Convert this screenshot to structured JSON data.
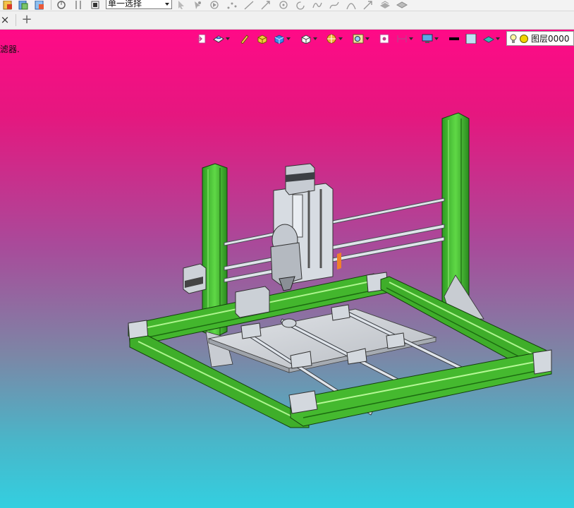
{
  "toolbar": {
    "selection_mode": "单一选择",
    "icons": [
      "document-icon",
      "copy-icon",
      "paste-icon",
      "rotate-icon",
      "reference-icon",
      "stop-icon",
      "pointer-icon",
      "cursor-icon",
      "play-icon",
      "points-icon",
      "line-icon",
      "arrow-line-icon",
      "circle-point-icon",
      "arc-icon",
      "curve-icon",
      "spline-icon",
      "loop-icon",
      "vector-icon",
      "surface-icon",
      "plane-icon"
    ]
  },
  "tab_bar": {
    "close_glyph": "×",
    "add_glyph": "+"
  },
  "viewport": {
    "label": "滤器.",
    "layer": {
      "name": "图层0000",
      "indicator_color": "#f2d400"
    },
    "background_top": "#ff0a87",
    "background_bottom": "#33cfe0",
    "view_tools": [
      "exit-sketch-icon",
      "view-orient-icon",
      "pencil-icon",
      "shaded-box-icon",
      "blue-box-icon",
      "white-box-icon",
      "section-icon",
      "zoom-fit-icon",
      "target-icon",
      "dimension-icon",
      "display-icon",
      "black-swatch",
      "light-blue-swatch",
      "plane-swatch-icon"
    ],
    "model": {
      "profile_color": "#36b52a",
      "rod_color": "#d8dde4",
      "plate_color": "#c9ccd0"
    }
  }
}
